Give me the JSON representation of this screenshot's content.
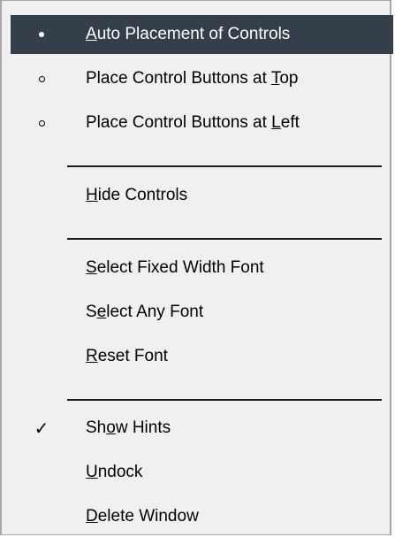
{
  "menu": {
    "items": [
      {
        "pre": "",
        "key": "A",
        "post": "uto Placement of Controls"
      },
      {
        "pre": "Place Control Buttons at ",
        "key": "T",
        "post": "op"
      },
      {
        "pre": "Place Control Buttons at ",
        "key": "L",
        "post": "eft"
      },
      {
        "pre": "",
        "key": "H",
        "post": "ide Controls"
      },
      {
        "pre": "",
        "key": "S",
        "post": "elect Fixed Width Font"
      },
      {
        "pre": "S",
        "key": "e",
        "post": "lect Any Font"
      },
      {
        "pre": "",
        "key": "R",
        "post": "eset Font"
      },
      {
        "pre": "Sh",
        "key": "o",
        "post": "w Hints"
      },
      {
        "pre": "",
        "key": "U",
        "post": "ndock"
      },
      {
        "pre": "",
        "key": "D",
        "post": "elete Window"
      }
    ],
    "checkmark_glyph": "✓",
    "colors": {
      "highlight": "#343f4a",
      "background": "#f0f0f0",
      "border": "#a7a7a7"
    }
  }
}
